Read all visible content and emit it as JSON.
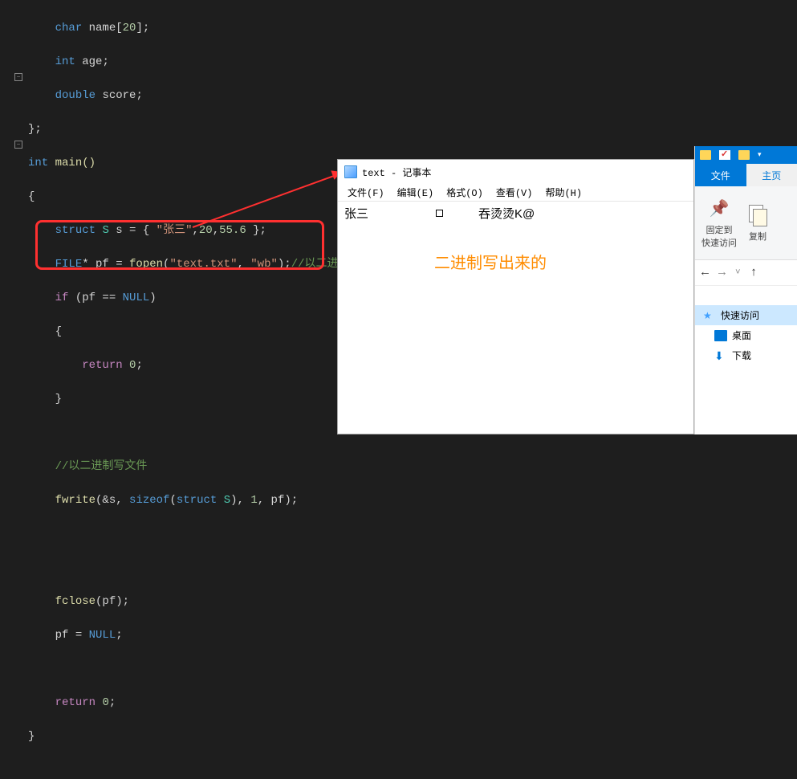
{
  "code": {
    "lines": [
      {
        "indent": 2,
        "text": "char name[20];"
      },
      {
        "indent": 2,
        "text": "int age;"
      },
      {
        "indent": 2,
        "text": "double score;"
      },
      {
        "indent": 0,
        "text": "};"
      },
      {
        "indent": 0,
        "text": "int main()"
      },
      {
        "indent": 0,
        "text": "{"
      },
      {
        "indent": 1,
        "text": "struct S s = { \"张三\",20,55.6 };"
      },
      {
        "indent": 1,
        "text": "FILE* pf = fopen(\"text.txt\", \"wb\");//以二进制写是 \" wb \""
      },
      {
        "indent": 1,
        "text": "if (pf == NULL)"
      },
      {
        "indent": 1,
        "text": "{"
      },
      {
        "indent": 2,
        "text": "return 0;"
      },
      {
        "indent": 1,
        "text": "}"
      },
      {
        "indent": 1,
        "text": ""
      },
      {
        "indent": 1,
        "text": "//以二进制写文件"
      },
      {
        "indent": 1,
        "text": "fwrite(&s, sizeof(struct S), 1, pf);"
      },
      {
        "indent": 1,
        "text": ""
      },
      {
        "indent": 1,
        "text": ""
      },
      {
        "indent": 1,
        "text": "fclose(pf);"
      },
      {
        "indent": 1,
        "text": "pf = NULL;"
      },
      {
        "indent": 1,
        "text": ""
      },
      {
        "indent": 1,
        "text": "return 0;"
      },
      {
        "indent": 0,
        "text": "}"
      }
    ]
  },
  "notepad": {
    "title": "text - 记事本",
    "menu": [
      "文件(F)",
      "编辑(E)",
      "格式(O)",
      "查看(V)",
      "帮助(H)"
    ],
    "content_parts": {
      "name": "张三",
      "garbled": "吞烫烫K@"
    },
    "annotation": "二进制写出来的"
  },
  "explorer": {
    "tabs": {
      "file": "文件",
      "home": "主页"
    },
    "ribbon": {
      "pin": {
        "line1": "固定到",
        "line2": "快速访问"
      },
      "copy": "复制"
    },
    "nav_symbols": {
      "back": "←",
      "forward": "→",
      "up": "↑",
      "recent": "˅"
    },
    "tree": {
      "quick_access": "快速访问",
      "desktop": "桌面",
      "downloads": "下载"
    }
  }
}
